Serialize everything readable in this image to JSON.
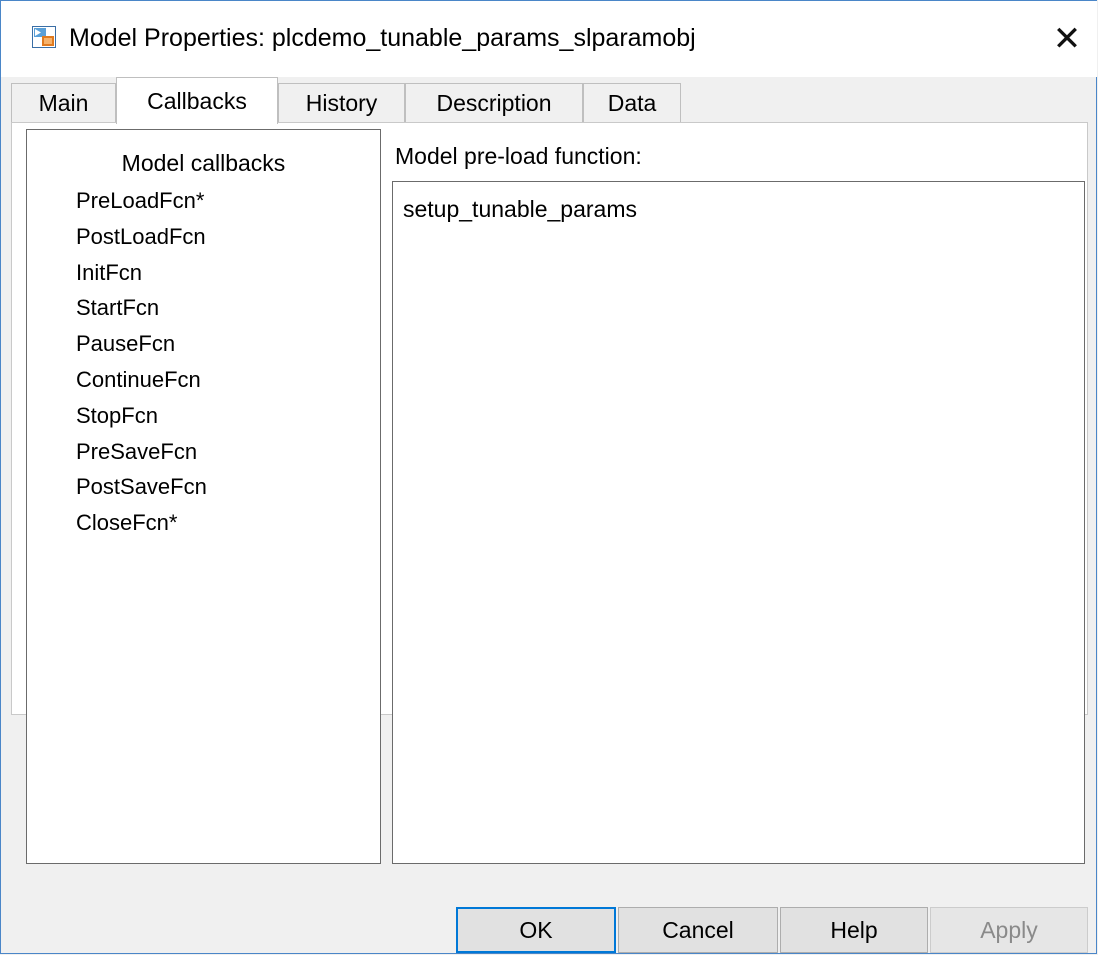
{
  "window": {
    "title": "Model Properties: plcdemo_tunable_params_slparamobj",
    "close_glyph": "✕",
    "app_icon": "simulink-model-icon"
  },
  "tabs": [
    {
      "label": "Main",
      "active": false
    },
    {
      "label": "Callbacks",
      "active": true
    },
    {
      "label": "History",
      "active": false
    },
    {
      "label": "Description",
      "active": false
    },
    {
      "label": "Data",
      "active": false
    }
  ],
  "callbacks_panel": {
    "header": "Model callbacks",
    "items": [
      "PreLoadFcn*",
      "PostLoadFcn",
      "InitFcn",
      "StartFcn",
      "PauseFcn",
      "ContinueFcn",
      "StopFcn",
      "PreSaveFcn",
      "PostSaveFcn",
      "CloseFcn*"
    ]
  },
  "function_editor": {
    "label": "Model pre-load function:",
    "value": "setup_tunable_params"
  },
  "buttons": {
    "ok": "OK",
    "cancel": "Cancel",
    "help": "Help",
    "apply": "Apply"
  },
  "colors": {
    "accent": "#0078d7",
    "window_border": "#4a86c8"
  }
}
